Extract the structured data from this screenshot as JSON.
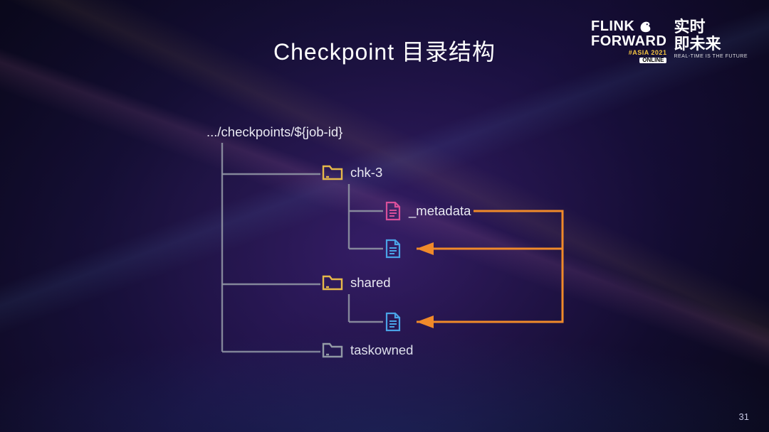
{
  "title": "Checkpoint 目录结构",
  "page_number": "31",
  "logo": {
    "line1": "FLINK",
    "line2": "FORWARD",
    "tag": "#ASIA 2021",
    "badge": "ONLINE",
    "cn_line1": "实时",
    "cn_line2": "即未来",
    "cn_sub": "REAL-TIME IS THE FUTURE"
  },
  "tree": {
    "root": ".../checkpoints/${job-id}",
    "nodes": {
      "chk3": "chk-3",
      "metadata": "_metadata",
      "shared": "shared",
      "taskowned": "taskowned"
    }
  },
  "colors": {
    "folder_gold": "#e6b84a",
    "folder_grey": "#9aa0a8",
    "file_pink": "#d94f9a",
    "file_blue": "#4aa3e6",
    "connector": "#8f94a3",
    "arrow_orange": "#f08a2a"
  }
}
